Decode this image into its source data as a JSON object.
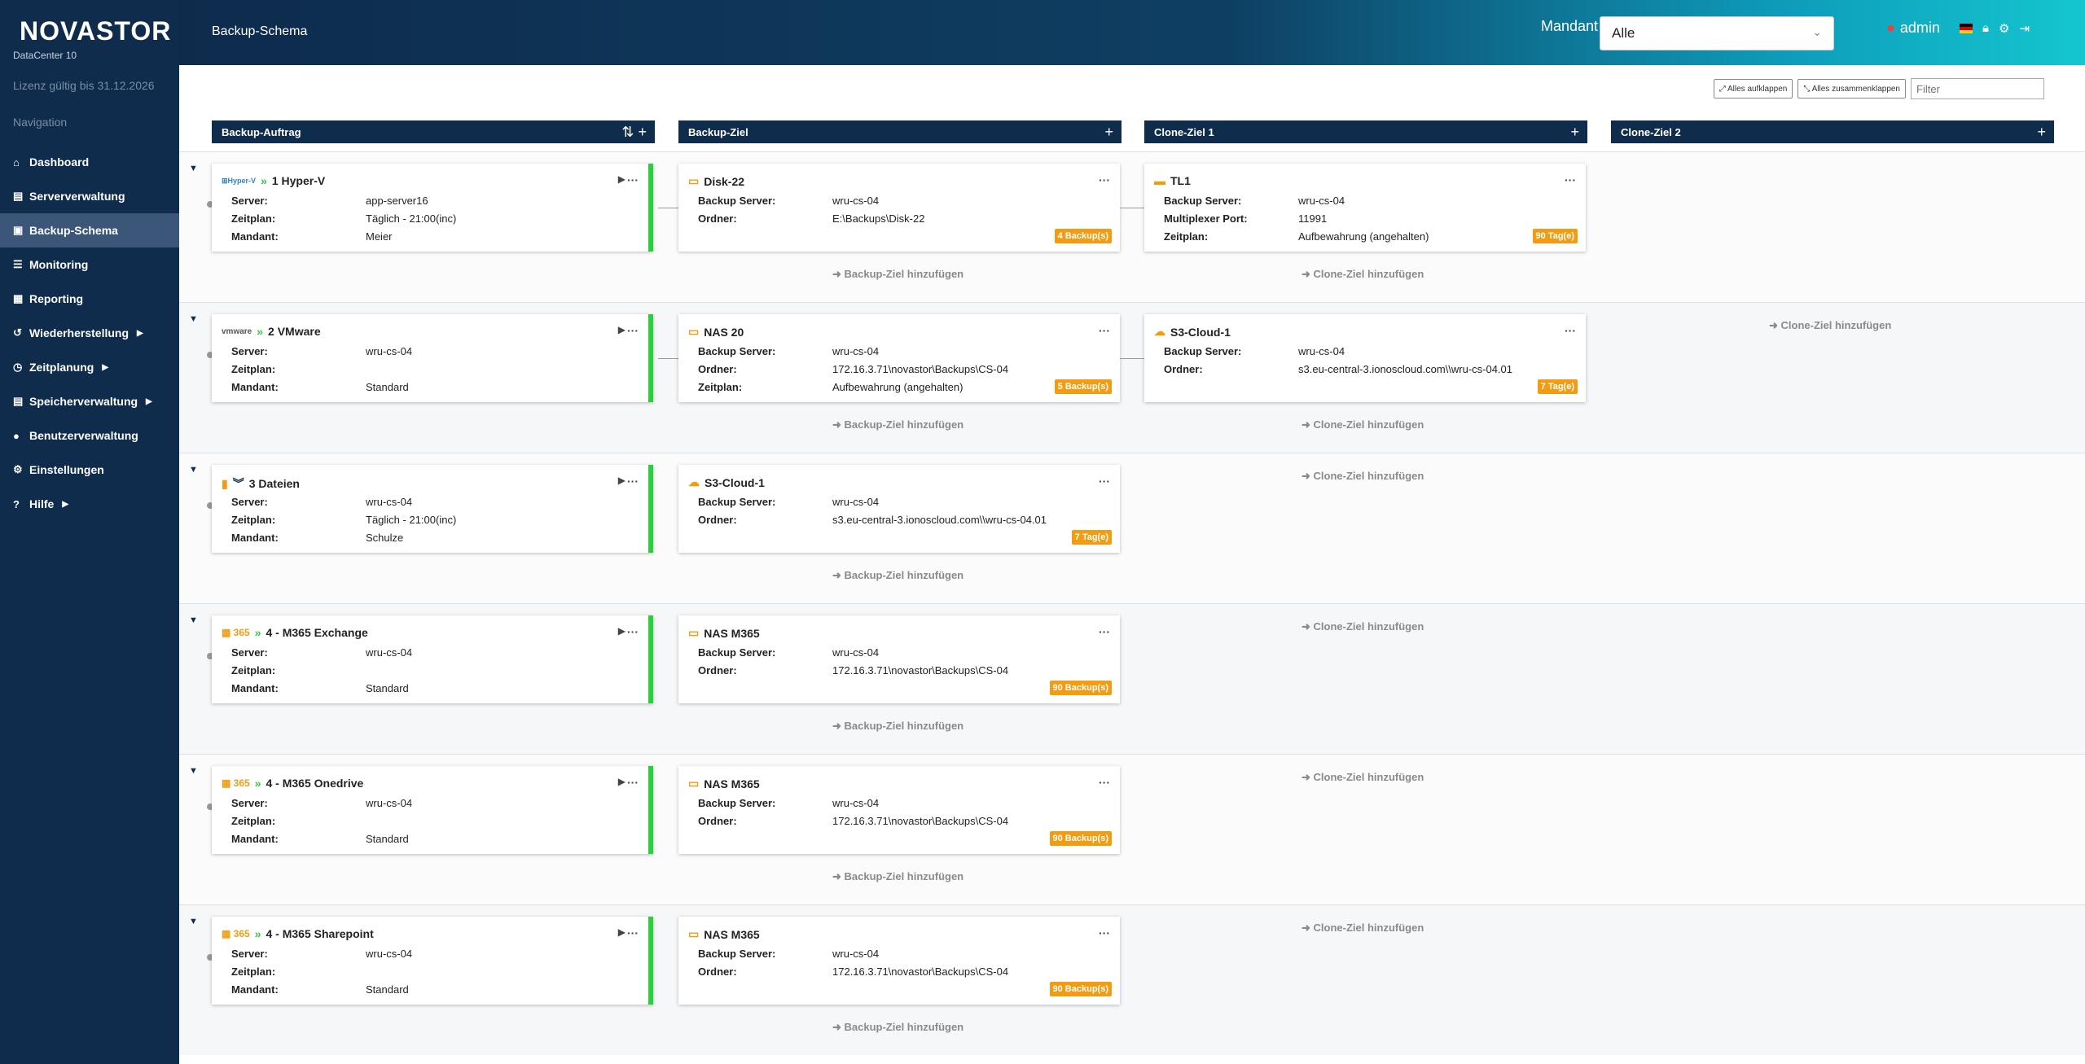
{
  "brand": {
    "logo": "NOVASTOR",
    "subtitle": "DataCenter 10",
    "license": "Lizenz gültig bis 31.12.2026"
  },
  "sidebar": {
    "heading": "Navigation",
    "items": [
      {
        "label": "Dashboard",
        "icon": "home-icon"
      },
      {
        "label": "Serververwaltung",
        "icon": "server-icon"
      },
      {
        "label": "Backup-Schema",
        "icon": "schema-icon"
      },
      {
        "label": "Monitoring",
        "icon": "list-icon"
      },
      {
        "label": "Reporting",
        "icon": "calendar-icon"
      },
      {
        "label": "Wiederherstellung",
        "icon": "restore-icon"
      },
      {
        "label": "Zeitplanung",
        "icon": "clock-icon"
      },
      {
        "label": "Speicherverwaltung",
        "icon": "storage-icon"
      },
      {
        "label": "Benutzerverwaltung",
        "icon": "user-icon"
      },
      {
        "label": "Einstellungen",
        "icon": "gear-icon"
      },
      {
        "label": "Hilfe",
        "icon": "help-icon"
      }
    ]
  },
  "header": {
    "title": "Backup-Schema",
    "mandant_label": "Mandant",
    "mandant_value": "Alle",
    "user": "admin"
  },
  "toolbar": {
    "expand_all": "Alles aufklappen",
    "collapse_all": "Alles zusammenklappen",
    "filter_placeholder": "Filter"
  },
  "columns": {
    "job": "Backup-Auftrag",
    "target": "Backup-Ziel",
    "clone1": "Clone-Ziel 1",
    "clone2": "Clone-Ziel 2"
  },
  "labels": {
    "server": "Server:",
    "zeitplan": "Zeitplan:",
    "mandant": "Mandant:",
    "backup_server": "Backup Server:",
    "ordner": "Ordner:",
    "multiplexer": "Multiplexer Port:",
    "add_target": "➜ Backup-Ziel hinzufügen",
    "add_clone": "➜ Clone-Ziel hinzufügen"
  },
  "rows": [
    {
      "job": {
        "name": "1 Hyper-V",
        "icon_text": "Hyper-V",
        "server": "app-server16",
        "zeitplan": "Täglich - 21:00(inc)",
        "mandant": "Meier"
      },
      "target": {
        "name": "Disk-22",
        "backup_server": "wru-cs-04",
        "ordner": "E:\\Backups\\Disk-22",
        "badge": "4 Backup(s)"
      },
      "clone1": {
        "name": "TL1",
        "backup_server": "wru-cs-04",
        "multiplexer": "11991",
        "zeitplan": "Aufbewahrung (angehalten)",
        "badge": "90 Tag(e)"
      }
    },
    {
      "job": {
        "name": "2 VMware",
        "icon_text": "vmware",
        "server": "wru-cs-04",
        "zeitplan": "",
        "mandant": "Standard"
      },
      "target": {
        "name": "NAS 20",
        "backup_server": "wru-cs-04",
        "ordner": "172.16.3.71\\novastor\\Backups\\CS-04",
        "zeitplan": "Aufbewahrung (angehalten)",
        "badge": "5 Backup(s)"
      },
      "clone1": {
        "name": "S3-Cloud-1",
        "backup_server": "wru-cs-04",
        "ordner": "s3.eu-central-3.ionoscloud.com\\\\wru-cs-04.01",
        "badge": "7 Tag(e)"
      }
    },
    {
      "job": {
        "name": "3 Dateien",
        "server": "wru-cs-04",
        "zeitplan": "Täglich - 21:00(inc)",
        "mandant": "Schulze"
      },
      "target": {
        "name": "S3-Cloud-1",
        "backup_server": "wru-cs-04",
        "ordner": "s3.eu-central-3.ionoscloud.com\\\\wru-cs-04.01",
        "badge": "7 Tag(e)"
      }
    },
    {
      "job": {
        "name": "4 - M365 Exchange",
        "icon_text": "365",
        "server": "wru-cs-04",
        "zeitplan": "",
        "mandant": "Standard"
      },
      "target": {
        "name": "NAS M365",
        "backup_server": "wru-cs-04",
        "ordner": "172.16.3.71\\novastor\\Backups\\CS-04",
        "badge": "90 Backup(s)"
      }
    },
    {
      "job": {
        "name": "4 - M365 Onedrive",
        "icon_text": "365",
        "server": "wru-cs-04",
        "zeitplan": "",
        "mandant": "Standard"
      },
      "target": {
        "name": "NAS M365",
        "backup_server": "wru-cs-04",
        "ordner": "172.16.3.71\\novastor\\Backups\\CS-04",
        "badge": "90 Backup(s)"
      }
    },
    {
      "job": {
        "name": "4 - M365 Sharepoint",
        "icon_text": "365",
        "server": "wru-cs-04",
        "zeitplan": "",
        "mandant": "Standard"
      },
      "target": {
        "name": "NAS M365",
        "backup_server": "wru-cs-04",
        "ordner": "172.16.3.71\\novastor\\Backups\\CS-04",
        "badge": "90 Backup(s)"
      }
    }
  ]
}
